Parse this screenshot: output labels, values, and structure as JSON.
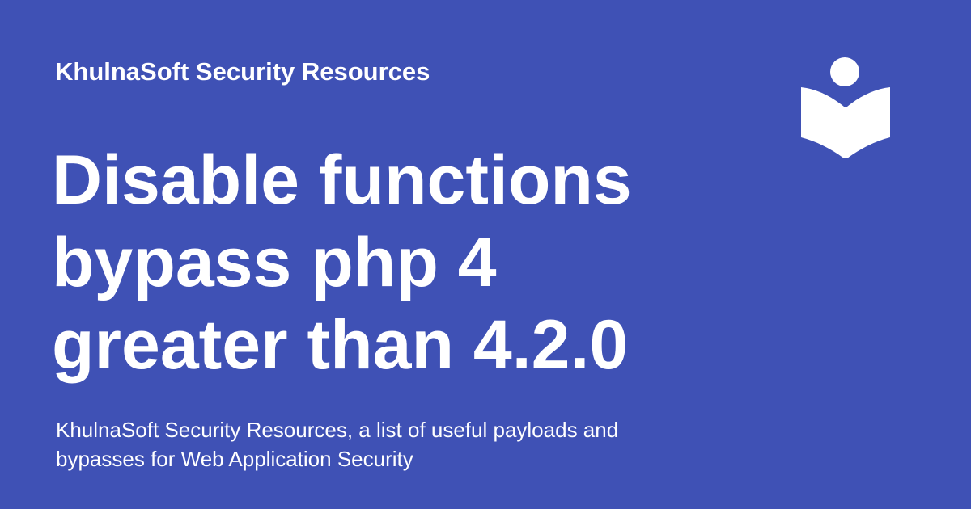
{
  "page": {
    "site_name": "KhulnaSoft Security Resources",
    "title_lines": [
      "Disable functions",
      "bypass php 4",
      "greater than 4.2.0"
    ],
    "description_lines": [
      "KhulnaSoft Security Resources, a list of useful payloads and",
      "bypasses for Web Application Security"
    ],
    "logo_icon": "book-reader-icon"
  },
  "colors": {
    "background": "#3f51b5",
    "foreground": "#ffffff"
  }
}
